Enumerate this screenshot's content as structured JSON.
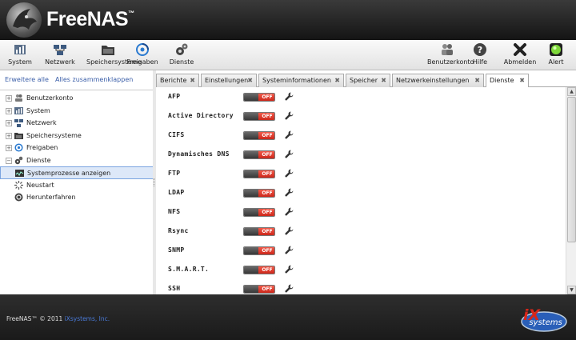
{
  "app": {
    "name": "FreeNAS",
    "trademark": "™"
  },
  "toolbar": {
    "left": [
      {
        "label": "System",
        "icon": "system-icon"
      },
      {
        "label": "Netzwerk",
        "icon": "network-icon"
      },
      {
        "label": "Speichersysteme",
        "icon": "storage-icon"
      },
      {
        "label": "Freigaben",
        "icon": "shares-icon"
      },
      {
        "label": "Dienste",
        "icon": "services-icon"
      }
    ],
    "right": [
      {
        "label": "Benutzerkonto",
        "icon": "account-icon"
      },
      {
        "label": "Hilfe",
        "icon": "help-icon"
      },
      {
        "label": "Abmelden",
        "icon": "logout-icon"
      },
      {
        "label": "Alert",
        "icon": "alert-icon"
      }
    ]
  },
  "sidebar": {
    "links": [
      "Erweitere alle",
      "Alles zusammenklappen"
    ],
    "tree": [
      {
        "label": "Benutzerkonto",
        "expander": "+"
      },
      {
        "label": "System",
        "expander": "+"
      },
      {
        "label": "Netzwerk",
        "expander": "+"
      },
      {
        "label": "Speichersysteme",
        "expander": "+"
      },
      {
        "label": "Freigaben",
        "expander": "+"
      },
      {
        "label": "Dienste",
        "expander": "−"
      },
      {
        "label": "Systemprozesse anzeigen",
        "selected": true
      },
      {
        "label": "Neustart"
      },
      {
        "label": "Herunterfahren"
      }
    ]
  },
  "tabs": [
    {
      "label": "Berichte"
    },
    {
      "label": "Einstellungen"
    },
    {
      "label": "Systeminformationen"
    },
    {
      "label": "Speicher"
    },
    {
      "label": "Netzwerkeinstellungen"
    },
    {
      "label": "Dienste",
      "active": true
    }
  ],
  "tab_close": "✖",
  "services": [
    {
      "name": "AFP",
      "state": "OFF"
    },
    {
      "name": "Active Directory",
      "state": "OFF"
    },
    {
      "name": "CIFS",
      "state": "OFF"
    },
    {
      "name": "Dynamisches DNS",
      "state": "OFF"
    },
    {
      "name": "FTP",
      "state": "OFF"
    },
    {
      "name": "LDAP",
      "state": "OFF"
    },
    {
      "name": "NFS",
      "state": "OFF"
    },
    {
      "name": "Rsync",
      "state": "OFF"
    },
    {
      "name": "SNMP",
      "state": "OFF"
    },
    {
      "name": "S.M.A.R.T.",
      "state": "OFF"
    },
    {
      "name": "SSH",
      "state": "OFF"
    }
  ],
  "footer": {
    "copyright": "FreeNAS™ © 2011 ",
    "company": "iXsystems, Inc.",
    "logo_text": "systems",
    "logo_prefix": "iX"
  },
  "colors": {
    "accent": "#3a5ea8",
    "off_red": "#d8261a",
    "header_dark": "#1e1e1e",
    "footer_link": "#4a7ad8"
  }
}
